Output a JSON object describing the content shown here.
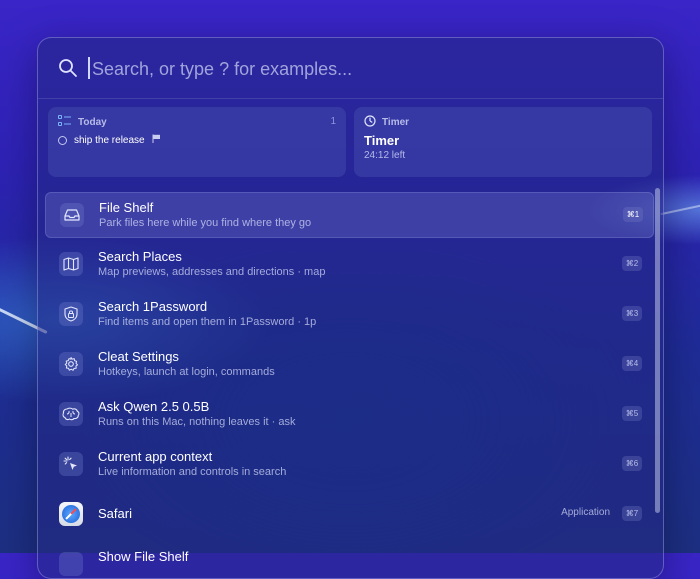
{
  "search": {
    "placeholder": "Search, or type ? for examples..."
  },
  "widgets": {
    "today": {
      "header": "Today",
      "count": "1",
      "task": "ship the release"
    },
    "timer": {
      "header": "Timer",
      "title": "Timer",
      "remaining": "24:12 left"
    }
  },
  "items": [
    {
      "title": "File Shelf",
      "subtitle": "Park files here while you find where they go",
      "shortcut": "⌘1",
      "icon": "inbox-tray-icon"
    },
    {
      "title": "Search Places",
      "subtitle": "Map previews, addresses and directions · map",
      "shortcut": "⌘2",
      "icon": "map-icon"
    },
    {
      "title": "Search 1Password",
      "subtitle": "Find items and open them in 1Password · 1p",
      "shortcut": "⌘3",
      "icon": "lock-shield-icon"
    },
    {
      "title": "Cleat Settings",
      "subtitle": "Hotkeys, launch at login, commands",
      "shortcut": "⌘4",
      "icon": "gear-icon"
    },
    {
      "title": "Ask Qwen 2.5 0.5B",
      "subtitle": "Runs on this Mac, nothing leaves it · ask",
      "shortcut": "⌘5",
      "icon": "brain-icon"
    },
    {
      "title": "Current app context",
      "subtitle": "Live information and controls in search",
      "shortcut": "⌘6",
      "icon": "sparkle-cursor-icon"
    },
    {
      "title": "Safari",
      "meta": "Application",
      "shortcut": "⌘7",
      "icon": "safari-icon"
    },
    {
      "title": "Show File Shelf"
    }
  ],
  "colors": {
    "accent": "#3a25c8",
    "panel": "#232882"
  }
}
